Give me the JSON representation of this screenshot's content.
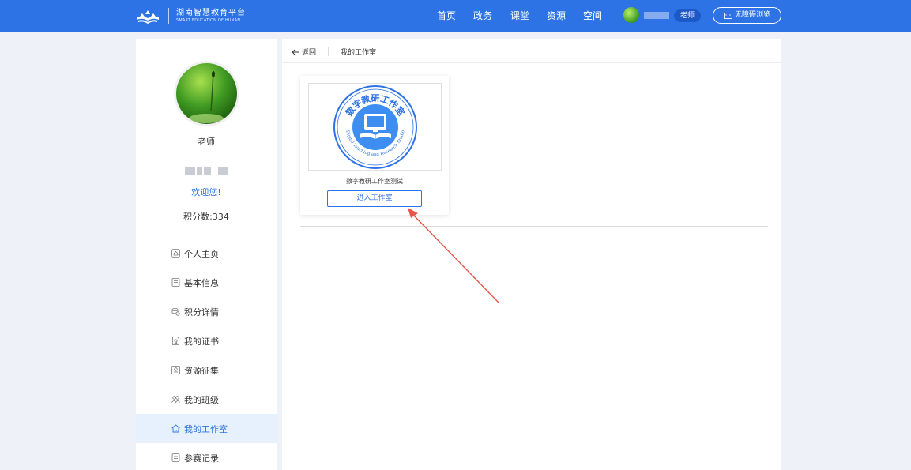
{
  "header": {
    "logo_title": "湖南智慧教育平台",
    "logo_subtitle": "SMART EDUCATION OF HUNAN",
    "nav": [
      "首页",
      "政务",
      "课堂",
      "资源",
      "空间"
    ],
    "role_badge": "老师",
    "accessibility_label": "无障碍浏览",
    "brand_color": "#2e73e6"
  },
  "sidebar": {
    "name": "老师",
    "welcome": "欢迎您!",
    "points_label": "积分数:",
    "points_value": "334",
    "items": [
      {
        "label": "个人主页",
        "icon": "home-icon"
      },
      {
        "label": "基本信息",
        "icon": "info-doc-icon"
      },
      {
        "label": "积分详情",
        "icon": "coins-icon"
      },
      {
        "label": "我的证书",
        "icon": "certificate-icon"
      },
      {
        "label": "资源征集",
        "icon": "resource-icon"
      },
      {
        "label": "我的班级",
        "icon": "class-icon"
      },
      {
        "label": "我的工作室",
        "icon": "studio-icon",
        "active": true
      },
      {
        "label": "参赛记录",
        "icon": "record-icon"
      }
    ]
  },
  "breadcrumb": {
    "back": "返回",
    "current": "我的工作室"
  },
  "studio_card": {
    "logo_title": "数字教研工作室",
    "logo_subtitle": "Digital Teaching and Research Studio",
    "title": "数字教研工作室测试",
    "enter_button": "进入工作室"
  },
  "annotation": {
    "arrow_color": "#e8554a"
  }
}
